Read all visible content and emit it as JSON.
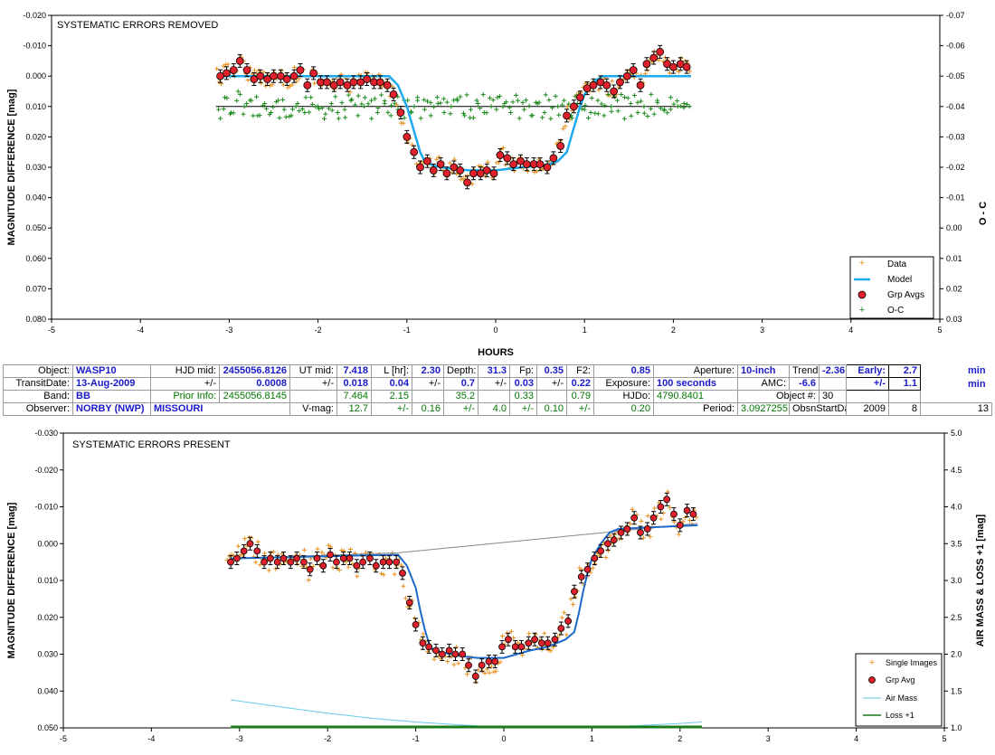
{
  "chart_data": [
    {
      "type": "scatter",
      "title": "SYSTEMATIC ERRORS REMOVED",
      "xlabel": "HOURS",
      "ylabel": "MAGNITUDE DIFFERENCE [mag]",
      "y2label": "O - C",
      "xlim": [
        -5,
        5
      ],
      "ylim": [
        -0.02,
        0.08
      ],
      "y2lim": [
        -0.07,
        0.03
      ],
      "y_inverted": true,
      "x_ticks": [
        "-5",
        "-4",
        "-3",
        "-2",
        "-1",
        "0",
        "1",
        "2",
        "3",
        "4",
        "5"
      ],
      "y_ticks": [
        "-0.020",
        "-0.010",
        "0.000",
        "0.010",
        "0.020",
        "0.030",
        "0.040",
        "0.050",
        "0.060",
        "0.070",
        "0.080"
      ],
      "y2_ticks": [
        "-0.07",
        "-0.06",
        "-0.05",
        "-0.04",
        "-0.03",
        "-0.02",
        "-0.01",
        "0.00",
        "0.01",
        "0.02",
        "0.03"
      ],
      "legend": {
        "placement": "bottom-right",
        "entries": [
          "Data",
          "Model",
          "Grp Avgs",
          "O-C"
        ]
      },
      "colors": {
        "data": "#e8901c",
        "model": "#1eaaee",
        "grp": "#e0202a",
        "oc": "#1a8a1a"
      },
      "series": [
        {
          "name": "Model",
          "x": [
            -3.1,
            -1.2,
            -1.1,
            -1.0,
            -0.95,
            -0.9,
            -0.85,
            -0.8,
            -0.7,
            -0.6,
            -0.5,
            -0.3,
            0.0,
            0.3,
            0.5,
            0.6,
            0.7,
            0.8,
            0.85,
            0.9,
            0.95,
            1.0,
            1.1,
            1.2,
            1.3,
            2.2
          ],
          "y": [
            0.0,
            0.0,
            0.003,
            0.01,
            0.015,
            0.02,
            0.025,
            0.028,
            0.0295,
            0.03,
            0.0305,
            0.031,
            0.031,
            0.03,
            0.0295,
            0.029,
            0.028,
            0.025,
            0.02,
            0.015,
            0.01,
            0.006,
            0.002,
            0.0,
            0.0,
            0.0
          ]
        },
        {
          "name": "Grp Avgs",
          "x": [
            -3.1,
            -3.03,
            -2.95,
            -2.88,
            -2.8,
            -2.72,
            -2.65,
            -2.57,
            -2.5,
            -2.42,
            -2.35,
            -2.27,
            -2.2,
            -2.12,
            -2.05,
            -1.97,
            -1.9,
            -1.82,
            -1.75,
            -1.67,
            -1.6,
            -1.52,
            -1.45,
            -1.37,
            -1.3,
            -1.22,
            -1.15,
            -1.07,
            -1.0,
            -0.92,
            -0.85,
            -0.77,
            -0.7,
            -0.62,
            -0.55,
            -0.47,
            -0.4,
            -0.32,
            -0.25,
            -0.17,
            -0.1,
            -0.02,
            0.05,
            0.13,
            0.2,
            0.28,
            0.35,
            0.43,
            0.5,
            0.58,
            0.65,
            0.73,
            0.8,
            0.88,
            0.95,
            1.03,
            1.1,
            1.18,
            1.25,
            1.33,
            1.4,
            1.48,
            1.55,
            1.63,
            1.7,
            1.78,
            1.85,
            1.93,
            2.0,
            2.08,
            2.15
          ],
          "y": [
            0.0,
            -0.001,
            -0.002,
            -0.005,
            -0.002,
            0.001,
            0.0,
            0.001,
            0.0,
            0.0,
            0.001,
            0.0,
            -0.002,
            0.003,
            -0.001,
            0.002,
            0.002,
            0.003,
            0.002,
            0.003,
            0.002,
            0.002,
            0.001,
            0.002,
            0.002,
            0.003,
            0.006,
            0.012,
            0.02,
            0.025,
            0.03,
            0.028,
            0.031,
            0.029,
            0.032,
            0.03,
            0.031,
            0.035,
            0.032,
            0.032,
            0.031,
            0.032,
            0.026,
            0.027,
            0.029,
            0.028,
            0.029,
            0.029,
            0.029,
            0.03,
            0.027,
            0.023,
            0.013,
            0.01,
            0.007,
            0.004,
            0.003,
            0.002,
            0.003,
            0.005,
            0.002,
            0.0,
            -0.002,
            0.003,
            -0.004,
            -0.006,
            -0.008,
            -0.004,
            -0.003,
            -0.004,
            -0.003
          ]
        },
        {
          "name": "O-C",
          "x": [
            -3.12,
            -3.05,
            -2.98,
            -2.9,
            -2.83,
            -2.75,
            -2.68,
            -2.6,
            -2.53,
            -2.45,
            -2.38,
            -2.3,
            -2.23,
            -2.15,
            -2.08,
            -2.0,
            -1.93,
            -1.85,
            -1.78,
            -1.7,
            -1.63,
            -1.55,
            -1.48,
            -1.4,
            -1.33,
            -1.25,
            -1.18,
            -1.1,
            -1.03,
            -0.95,
            -0.88,
            -0.8,
            -0.73,
            -0.65,
            -0.58,
            -0.5,
            -0.43,
            -0.35,
            -0.28,
            -0.2,
            -0.13,
            -0.05,
            0.02,
            0.1,
            0.17,
            0.25,
            0.32,
            0.4,
            0.47,
            0.55,
            0.62,
            0.7,
            0.77,
            0.85,
            0.92,
            1.0,
            1.07,
            1.15,
            1.22,
            1.3,
            1.37,
            1.45,
            1.52,
            1.6,
            1.67,
            1.75,
            1.82,
            1.9,
            1.97,
            2.05,
            2.12,
            2.18
          ],
          "y": [
            0.001,
            -0.003,
            0.002,
            -0.005,
            0.0,
            -0.002,
            0.003,
            -0.001,
            0.002,
            -0.002,
            0.001,
            0.003,
            -0.001,
            0.002,
            -0.003,
            0.0,
            0.004,
            -0.001,
            0.002,
            0.001,
            -0.002,
            0.003,
            0.0,
            -0.002,
            0.002,
            -0.001,
            0.003,
            0.001,
            -0.002,
            0.002,
            -0.003,
            0.001,
            0.003,
            -0.001,
            0.002,
            0.0,
            -0.002,
            0.003,
            0.001,
            -0.001,
            0.002,
            0.0,
            -0.003,
            -0.001,
            0.002,
            -0.002,
            0.001,
            0.003,
            -0.001,
            0.002,
            0.004,
            0.0,
            -0.002,
            0.003,
            -0.001,
            0.001,
            0.002,
            -0.002,
            0.003,
            0.0,
            -0.002,
            0.004,
            -0.001,
            0.002,
            0.0,
            -0.004,
            -0.002,
            0.001,
            -0.003,
            0.0,
            -0.001,
            0.0
          ]
        }
      ]
    },
    {
      "type": "scatter",
      "title": "SYSTEMATIC ERRORS PRESENT",
      "xlabel": "",
      "ylabel": "MAGNITUDE DIFFERENCE [mag]",
      "y2label": "AIR MASS & LOSS +1 [mag]",
      "xlim": [
        -5,
        5
      ],
      "ylim": [
        -0.03,
        0.05
      ],
      "y2lim": [
        1.0,
        5.0
      ],
      "y_inverted": true,
      "x_ticks": [
        "-5",
        "-4",
        "-3",
        "-2",
        "-1",
        "0",
        "1",
        "2",
        "3",
        "4",
        "5"
      ],
      "y_ticks": [
        "-0.030",
        "-0.020",
        "-0.010",
        "0.000",
        "0.010",
        "0.020",
        "0.030",
        "0.040",
        "0.050"
      ],
      "y2_ticks": [
        "5.0",
        "4.5",
        "4.0",
        "3.5",
        "3.0",
        "2.5",
        "2.0",
        "1.5",
        "1.0"
      ],
      "legend": {
        "placement": "bottom-right",
        "entries": [
          "Single Images",
          "Grp Avg",
          "Air Mass",
          "Loss +1"
        ]
      },
      "colors": {
        "data": "#e8901c",
        "model": "#1e6acc",
        "grp": "#e0202a",
        "air": "#6ac8e8",
        "loss": "#1a7a1a",
        "trend": "#888888"
      },
      "series": [
        {
          "name": "Model",
          "x": [
            -3.1,
            -1.2,
            -1.1,
            -1.0,
            -0.95,
            -0.9,
            -0.85,
            -0.8,
            -0.7,
            -0.6,
            -0.5,
            -0.3,
            0.0,
            0.3,
            0.5,
            0.6,
            0.7,
            0.8,
            0.85,
            0.9,
            0.95,
            1.0,
            1.1,
            1.2,
            1.3,
            2.2
          ],
          "y": [
            0.004,
            0.003,
            0.006,
            0.012,
            0.018,
            0.023,
            0.027,
            0.029,
            0.0295,
            0.03,
            0.0305,
            0.031,
            0.031,
            0.029,
            0.028,
            0.027,
            0.026,
            0.024,
            0.019,
            0.013,
            0.008,
            0.004,
            0.0,
            -0.003,
            -0.004,
            -0.005
          ]
        },
        {
          "name": "Trend",
          "x": [
            -3.1,
            -1.2,
            2.2
          ],
          "y": [
            0.004,
            0.0025,
            -0.0055
          ]
        },
        {
          "name": "Grp Avg",
          "x": [
            -3.1,
            -3.03,
            -2.95,
            -2.88,
            -2.8,
            -2.72,
            -2.65,
            -2.57,
            -2.5,
            -2.42,
            -2.35,
            -2.27,
            -2.2,
            -2.12,
            -2.05,
            -1.97,
            -1.9,
            -1.82,
            -1.75,
            -1.67,
            -1.6,
            -1.52,
            -1.45,
            -1.37,
            -1.3,
            -1.22,
            -1.15,
            -1.07,
            -1.0,
            -0.92,
            -0.85,
            -0.77,
            -0.7,
            -0.62,
            -0.55,
            -0.47,
            -0.4,
            -0.32,
            -0.25,
            -0.17,
            -0.1,
            -0.02,
            0.05,
            0.13,
            0.2,
            0.28,
            0.35,
            0.43,
            0.5,
            0.58,
            0.65,
            0.73,
            0.8,
            0.88,
            0.95,
            1.03,
            1.1,
            1.18,
            1.25,
            1.33,
            1.4,
            1.48,
            1.55,
            1.63,
            1.7,
            1.78,
            1.85,
            1.93,
            2.0,
            2.08,
            2.15
          ],
          "y": [
            0.005,
            0.004,
            0.002,
            0.0,
            0.002,
            0.005,
            0.004,
            0.005,
            0.004,
            0.005,
            0.004,
            0.005,
            0.007,
            0.004,
            0.006,
            0.003,
            0.005,
            0.004,
            0.004,
            0.006,
            0.005,
            0.004,
            0.006,
            0.005,
            0.005,
            0.005,
            0.008,
            0.016,
            0.022,
            0.027,
            0.028,
            0.029,
            0.03,
            0.029,
            0.03,
            0.03,
            0.033,
            0.036,
            0.033,
            0.032,
            0.032,
            0.028,
            0.026,
            0.028,
            0.028,
            0.027,
            0.026,
            0.027,
            0.027,
            0.026,
            0.023,
            0.021,
            0.013,
            0.009,
            0.007,
            0.004,
            0.002,
            0.0,
            -0.001,
            -0.003,
            -0.004,
            -0.007,
            -0.003,
            -0.004,
            -0.007,
            -0.01,
            -0.012,
            -0.008,
            -0.005,
            -0.009,
            -0.008
          ]
        },
        {
          "name": "Air Mass",
          "x": [
            -3.1,
            -2.5,
            -2.0,
            -1.5,
            -1.0,
            -0.5,
            0.0,
            0.5,
            1.0,
            1.5,
            2.0,
            2.25
          ],
          "y": [
            1.38,
            1.28,
            1.2,
            1.13,
            1.08,
            1.04,
            1.01,
            1.0,
            1.01,
            1.03,
            1.06,
            1.08
          ]
        },
        {
          "name": "Loss +1",
          "x": [
            -3.1,
            2.25
          ],
          "y": [
            1.0,
            1.0
          ]
        }
      ]
    }
  ],
  "info_table": {
    "r1": {
      "object_l": "Object:",
      "object_v": "WASP10",
      "hjdmid_l": "HJD mid:",
      "hjdmid_v": "2455056.8126",
      "utmid_l": "UT mid:",
      "utmid_v": "7.418",
      "lhr_l": "L [hr]:",
      "lhr_v": "2.30",
      "depth_l": "Depth:",
      "depth_v": "31.3",
      "fp_l": "Fp:",
      "fp_v": "0.35",
      "f2_l": "F2:",
      "f2_v": "0.85",
      "aperture_l": "Aperture:",
      "aperture_v": "10-inch",
      "trend_l": "Trend:",
      "trend_v": "-2.36",
      "early_l": "Early:",
      "early_v": "2.7",
      "early_u": "min"
    },
    "r2": {
      "transit_l": "TransitDate:",
      "transit_v": "13-Aug-2009",
      "pm1": "+/-",
      "hjd_err": "0.0008",
      "pm2": "+/-",
      "ut_err": "0.018",
      "l_err": "0.04",
      "pm3": "+/-",
      "depth_err": "0.7",
      "pm4": "+/-",
      "fp_err": "0.03",
      "pm5": "+/-",
      "f2_err": "0.22",
      "exposure_l": "Exposure:",
      "exposure_v": "100 seconds",
      "amc_l": "AMC:",
      "amc_v": "-6.6",
      "pm6": "+/-",
      "early_err": "1.1",
      "early_u": "min"
    },
    "r3": {
      "band_l": "Band:",
      "band_v": "BB",
      "prior_l": "Prior Info:",
      "prior_hjd": "2455056.8145",
      "prior_ut": "7.464",
      "prior_l_hr": "2.15",
      "prior_depth": "35.2",
      "prior_fp": "0.33",
      "prior_f2": "0.79",
      "hjdo_l": "HJDo:",
      "hjdo_v": "4790.8401",
      "objnum_l": "Object #:",
      "objnum_v": "30"
    },
    "r4": {
      "observer_l": "Observer:",
      "observer_v": "NORBY (NWP)",
      "loc_v": "MISSOURI",
      "vmag_l": "V-mag:",
      "vmag_v": "12.7",
      "pm1": "+/-",
      "vmag_err1": "0.16",
      "pm2": "+/-",
      "vmag_err2": "4.0",
      "pm3": "+/-",
      "vmag_err3": "0.10",
      "pm4": "+/-",
      "vmag_err4": "0.20",
      "period_l": "Period:",
      "period_v": "3.0927255",
      "obsn_l": "ObsnStartDate:",
      "obsn_y": "2009",
      "obsn_m": "8",
      "obsn_d": "13"
    }
  }
}
